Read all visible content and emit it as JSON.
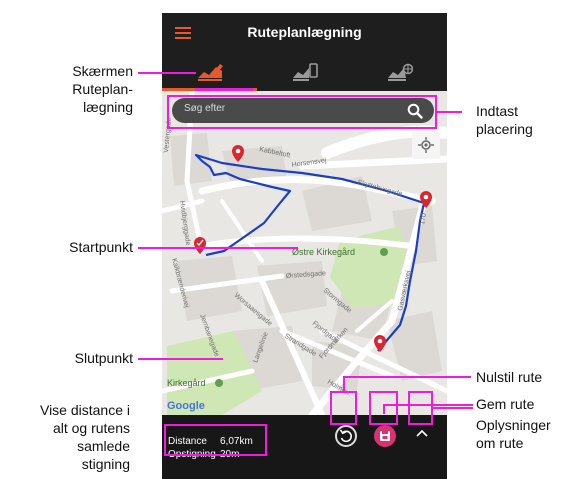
{
  "app": {
    "title": "Ruteplanlægning"
  },
  "search": {
    "placeholder": "Søg efter"
  },
  "map": {
    "streets": [
      "Kabbeltoft",
      "Horsensvej",
      "Skyttehusgade",
      "Gasværksvej",
      "Østre Kirkegård",
      "Ørstedsgade",
      "Stormgade",
      "Fjordgade",
      "Strandgade",
      "Fjordmarken",
      "Holmen",
      "Langelinie",
      "Worsaaesgade",
      "Jernbanegade",
      "Kalkbrænderivej",
      "Hvidbjerggade",
      "Kirkegård",
      "Vestergade",
      "170"
    ],
    "provider": "Google"
  },
  "stats": {
    "distance_label": "Distance",
    "distance_value": "6,07km",
    "ascent_label": "Opstigning",
    "ascent_value": "20m"
  },
  "annotations": {
    "screen": [
      "Skærmen",
      "Ruteplan-",
      "lægning"
    ],
    "search": [
      "Indtast",
      "placering"
    ],
    "start": "Startpunkt",
    "end": "Slutpunkt",
    "reset": "Nulstil rute",
    "save": "Gem rute",
    "info": [
      "Oplysninger",
      "om rute"
    ],
    "distance": [
      "Vise distance i",
      "alt og rutens",
      "samlede",
      "stigning"
    ]
  },
  "colors": {
    "accent": "#e8582a",
    "highlight": "#ee1dd8",
    "route": "#1a3fc4",
    "pin": "#d9262f",
    "save": "#d8336f"
  }
}
